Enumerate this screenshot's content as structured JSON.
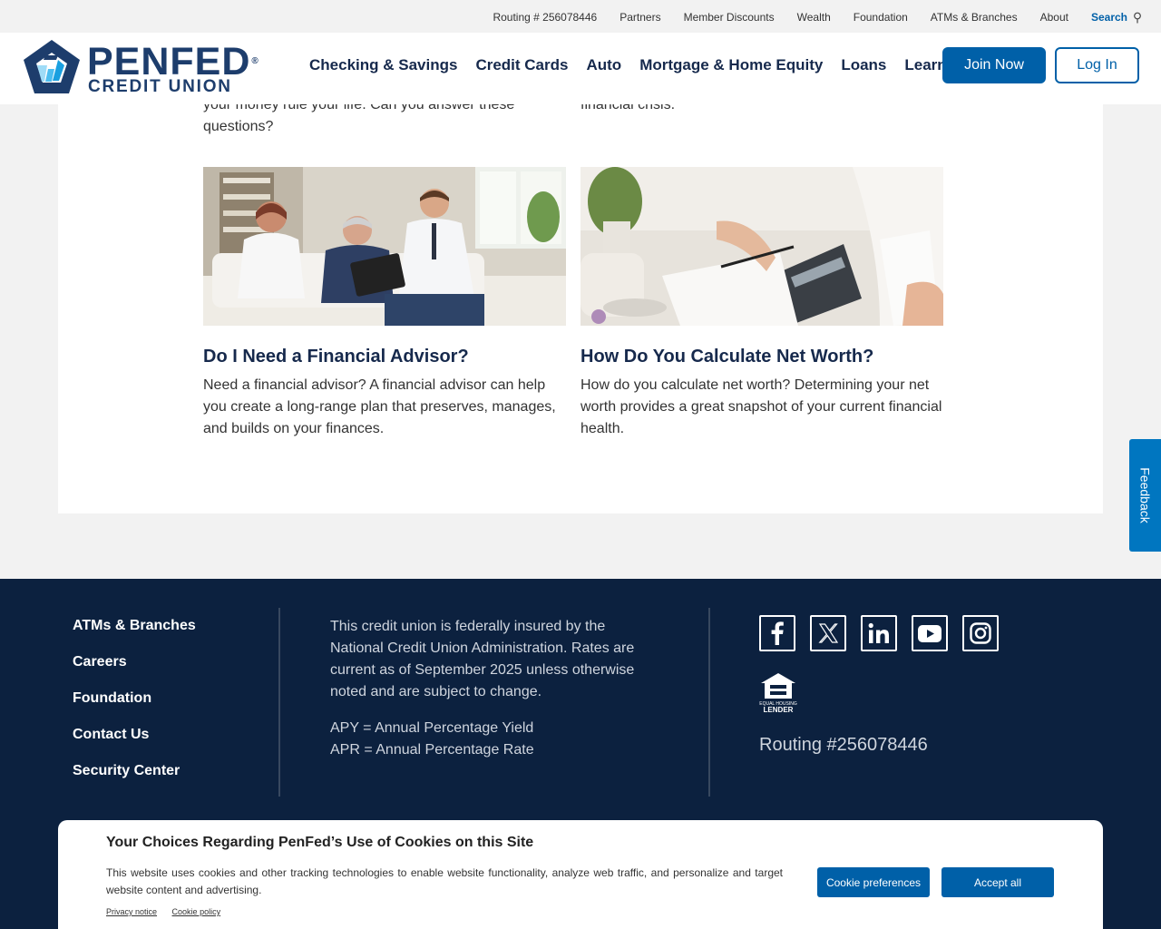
{
  "utility_nav": {
    "routing": "Routing # 256078446",
    "items": [
      "Partners",
      "Member Discounts",
      "Wealth",
      "Foundation",
      "ATMs & Branches",
      "About"
    ],
    "search_label": "Search"
  },
  "logo": {
    "line1": "PENFED",
    "registered": "®",
    "line2": "CREDIT UNION"
  },
  "primary_nav": [
    "Checking & Savings",
    "Credit Cards",
    "Auto",
    "Mortgage & Home Equity",
    "Loans",
    "Learn"
  ],
  "header_buttons": {
    "join": "Join Now",
    "login": "Log In"
  },
  "prev_articles": {
    "left_text_line1": "your money rule your life. Can you answer these",
    "left_text_line2": "questions?",
    "right_text": "financial crisis."
  },
  "articles": [
    {
      "title": "Do I Need a Financial Advisor?",
      "description": "Need a financial advisor? A financial advisor can help you create a long-range plan that preserves, manages, and builds on your finances."
    },
    {
      "title": "How Do You Calculate Net Worth?",
      "description": "How do you calculate net worth? Determining your net worth provides a great snapshot of your current financial health."
    }
  ],
  "feedback_label": "Feedback",
  "footer": {
    "links": [
      "ATMs & Branches",
      "Careers",
      "Foundation",
      "Contact Us",
      "Security Center"
    ],
    "insurance_text": "This credit union is federally insured by the National Credit Union Administration. Rates are current as of September 2025 unless otherwise noted and are subject to change.",
    "apy": "APY = Annual Percentage Yield",
    "apr": "APR = Annual Percentage Rate",
    "socials": [
      "facebook-icon",
      "x-icon",
      "linkedin-icon",
      "youtube-icon",
      "instagram-icon"
    ],
    "equal_housing_lines": [
      "EQUAL HOUSING",
      "LENDER"
    ],
    "routing": "Routing #256078446"
  },
  "cookie_banner": {
    "title": "Your Choices Regarding PenFed’s Use of Cookies on this Site",
    "text": "This website uses cookies and other tracking technologies to enable website functionality, analyze web traffic, and personalize and target website content and advertising.",
    "privacy_link": "Privacy notice",
    "cookie_link": "Cookie policy",
    "preferences_button": "Cookie preferences",
    "accept_button": "Accept all"
  },
  "colors": {
    "brand_blue": "#0060a8",
    "navy": "#16294c",
    "footer_bg": "#0c213f",
    "feedback_blue": "#0076c0"
  }
}
